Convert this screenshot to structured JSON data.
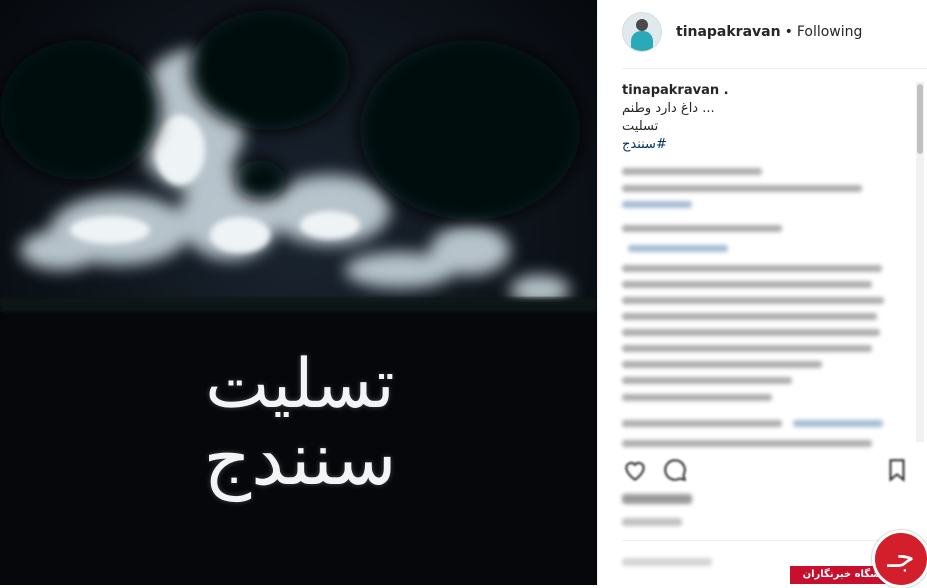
{
  "post": {
    "image_text_line1": "تسلیت",
    "image_text_line2": "سنندج"
  },
  "header": {
    "username": "tinapakravan",
    "separator": "•",
    "follow_status": "Following"
  },
  "caption": {
    "owner": "tinapakravan .",
    "line1": "... داغ دارد وطنم",
    "line2": "تسلیت",
    "hashtag": "#سنندج"
  },
  "icons": {
    "like": "heart-icon",
    "comment": "comment-icon",
    "save": "bookmark-icon"
  },
  "watermark": {
    "label": "باشگاه خبرنگاران",
    "glyph": "جـ",
    "color": "#c8102e"
  }
}
